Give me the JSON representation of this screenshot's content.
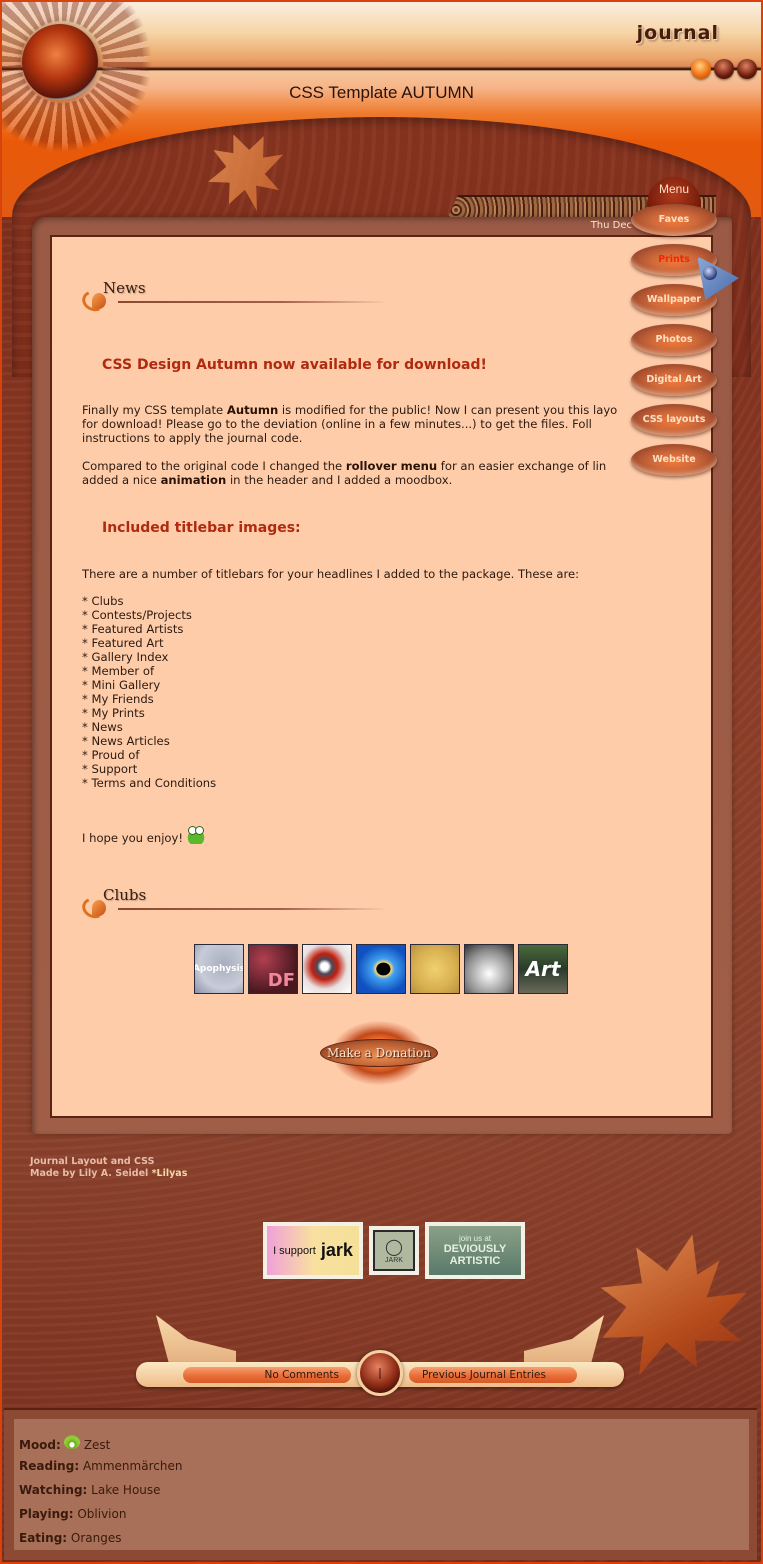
{
  "header": {
    "logo": "JOURNAL",
    "title": "CSS Template AUTUMN",
    "dots": [
      {
        "active": true
      },
      {
        "active": false
      },
      {
        "active": false
      }
    ]
  },
  "menu": {
    "label": "Menu",
    "items": [
      {
        "label": "Faves",
        "active": false
      },
      {
        "label": "Prints",
        "active": true
      },
      {
        "label": "Wallpaper",
        "active": false
      },
      {
        "label": "Photos",
        "active": false
      },
      {
        "label": "Digital Art",
        "active": false
      },
      {
        "label": "CSS layouts",
        "active": false
      },
      {
        "label": "Website",
        "active": false
      }
    ]
  },
  "entry": {
    "date": "Thu Dec 14, 20",
    "news_section": "News",
    "headline": "CSS Design Autumn now available for download!",
    "p1": {
      "l1_a": "Finally my CSS template ",
      "l1_b": "Autumn",
      "l1_c": " is modified for the public! Now I can present you this layo",
      "l2": "for download! Please go to the deviation (online in a few minutes...) to get the files. Foll",
      "l3": "instructions to apply the journal code."
    },
    "p2": {
      "l1_a": "Compared to the original code I changed the ",
      "l1_b": "rollover menu",
      "l1_c": " for an easier exchange of lin",
      "l2_a": "added a nice ",
      "l2_b": "animation",
      "l2_c": " in the header and I added a moodbox."
    },
    "subheading": "Included titlebar images:",
    "list_intro": "There are a number of titlebars for your headlines I added to the package. These are:",
    "titlebars": [
      "* Clubs",
      "* Contests/Projects",
      "* Featured Artists",
      "* Featured Art",
      "* Gallery Index",
      "* Member of",
      "* Mini Gallery",
      "* My Friends",
      "* My Prints",
      "* News",
      "* News Articles",
      "* Proud of",
      "* Support",
      "* Terms and Conditions"
    ],
    "closing": "I hope you enjoy!",
    "clubs_section": "Clubs",
    "club_icons": [
      "Apophysis",
      "DF",
      "",
      "",
      "",
      "",
      "Art"
    ],
    "donate": "Make a Donation"
  },
  "footer": {
    "credit_line1": "Journal Layout and CSS",
    "credit_line2": "Made by Lily A. Seidel ",
    "credit_link": "*Lilyas",
    "stamps": [
      {
        "line1": "I support",
        "line2": "jark"
      },
      {
        "line1": "",
        "line2": "JARK"
      },
      {
        "line1": "join us at",
        "line2": "DEVIOUSLY ARTISTIC"
      }
    ],
    "nav_left": "No Comments",
    "nav_center": "|",
    "nav_right": "Previous Journal Entries"
  },
  "moodbox": {
    "rows": [
      {
        "label": "Mood:",
        "value": "Zest"
      },
      {
        "label": "Reading:",
        "value": "Ammenmärchen"
      },
      {
        "label": "Watching:",
        "value": "Lake House"
      },
      {
        "label": "Playing:",
        "value": "Oblivion"
      },
      {
        "label": "Eating:",
        "value": "Oranges"
      }
    ]
  }
}
